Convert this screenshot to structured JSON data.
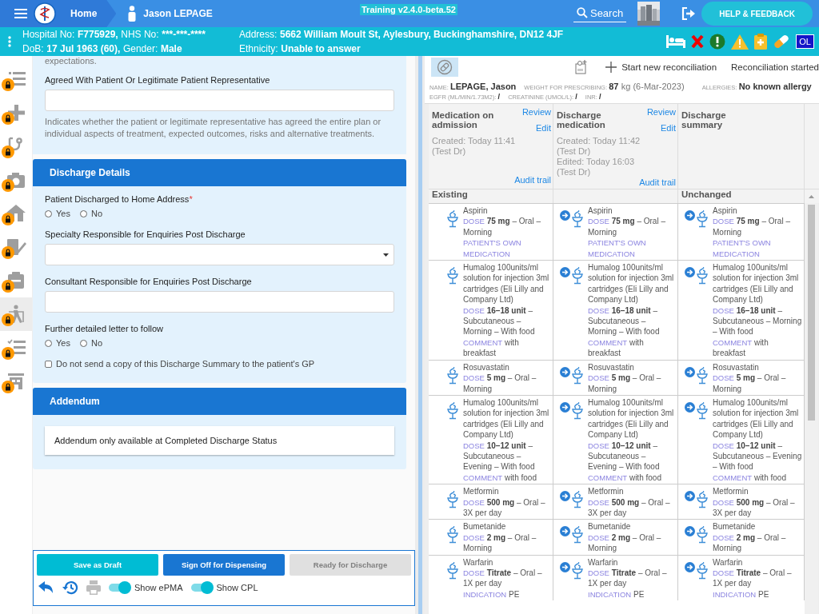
{
  "top_bar": {
    "home": "Home",
    "patient": "Jason LEPAGE",
    "environment": "Training v2.4.0-beta.52",
    "search": "Search",
    "help_button": "HELP & FEEDBACK"
  },
  "patient_banner": {
    "columns": [
      [
        [
          {
            "label": "Hospital No:",
            "value": "F775929,"
          },
          {
            "label": "NHS No:",
            "value": "***-***-****"
          }
        ],
        [
          {
            "label": "DoB:",
            "value": "17 Jul 1963 (60),"
          },
          {
            "label": "Gender:",
            "value": "Male"
          }
        ]
      ],
      [
        [
          {
            "label": "Address:",
            "value": "5662 William Moult St, Aylesbury, Buckinghamshire, DN12 4JF"
          }
        ],
        [
          {
            "label": "Ethnicity:",
            "value": "Unable to answer"
          }
        ]
      ]
    ],
    "alerts": [
      {
        "kind": "bed"
      },
      {
        "kind": "cross"
      },
      {
        "kind": "exclamation"
      },
      {
        "kind": "warning"
      },
      {
        "kind": "clipboard"
      },
      {
        "kind": "pill"
      },
      {
        "kind": "badge",
        "text": "OL"
      }
    ]
  },
  "sidebar": {
    "items": [
      {
        "kind": "list",
        "locked": true,
        "selected": false
      },
      {
        "kind": "plus",
        "locked": true,
        "selected": false
      },
      {
        "kind": "stethoscope",
        "locked": true,
        "selected": false
      },
      {
        "kind": "camera",
        "locked": true,
        "selected": false
      },
      {
        "kind": "home",
        "locked": true,
        "selected": false
      },
      {
        "kind": "edit",
        "locked": true,
        "selected": false
      },
      {
        "kind": "clipboard",
        "locked": true,
        "selected": false
      },
      {
        "kind": "walker",
        "locked": true,
        "selected": true
      },
      {
        "kind": "checklist",
        "locked": true,
        "selected": false
      },
      {
        "kind": "building",
        "locked": true,
        "selected": false
      }
    ]
  },
  "form": {
    "sections": [
      {
        "fields": [
          {
            "kind": "paragraph",
            "text": "expectations."
          },
          {
            "kind": "text",
            "label": "Agreed With Patient Or Legitimate Patient Representative",
            "help": "Indicates whether the patient or legitimate representative has agreed the entire plan or individual aspects of treatment, expected outcomes, risks and alternative treatments."
          }
        ]
      },
      {
        "title": "Discharge Details",
        "fields": [
          {
            "kind": "radio",
            "label": "Patient Discharged to Home Address",
            "required_mark": "*",
            "options": [
              {
                "label": "Yes",
                "selected": false
              },
              {
                "label": "No",
                "selected": false
              }
            ]
          },
          {
            "kind": "select",
            "label": "Specialty Responsible for Enquiries Post Discharge"
          },
          {
            "kind": "text",
            "label": "Consultant Responsible for Enquiries Post Discharge"
          },
          {
            "kind": "radio",
            "label": "Further detailed letter to follow",
            "options": [
              {
                "label": "Yes",
                "selected": false
              },
              {
                "label": "No",
                "selected": false
              }
            ]
          },
          {
            "kind": "checkbox",
            "label": "Do not send a copy of this Discharge Summary to the patient's GP",
            "checked": false
          }
        ]
      },
      {
        "title": "Addendum",
        "fields": [
          {
            "kind": "note",
            "text": "Addendum only available at Completed Discharge Status"
          }
        ]
      }
    ],
    "actions": [
      {
        "label": "Save as Draft",
        "kind": "draft",
        "disabled": false
      },
      {
        "label": "Sign Off for Dispensing",
        "kind": "sign",
        "disabled": false
      },
      {
        "label": "Ready for Discharge",
        "kind": "ready",
        "disabled": true
      }
    ],
    "tools": [
      {
        "kind": "undo",
        "disabled": false
      },
      {
        "kind": "history",
        "disabled": false
      },
      {
        "kind": "print",
        "disabled": true
      }
    ],
    "toggles": [
      {
        "label": "Show ePMA",
        "on": true
      },
      {
        "label": "Show CPL",
        "on": true
      }
    ]
  },
  "reconciliation": {
    "toolbar": {
      "start": "Start new reconciliation",
      "status": "Reconciliation started"
    },
    "patient": [
      [
        {
          "label": "NAME:",
          "value": "LEPAGE, Jason"
        },
        {
          "label": "WEIGHT FOR PRESCRIBING:",
          "value": "87",
          "unit": "kg (6-Mar-2023)"
        },
        {
          "label": "ALLERGIES:",
          "value": "No known allergy"
        }
      ],
      [
        {
          "label": "EGFR (ML/MIN/1.73M2):",
          "value": "/"
        },
        {
          "label": "CREATININE (UMOL/L):",
          "value": "/"
        },
        {
          "label": "INR:",
          "value": "/"
        }
      ]
    ],
    "columns": [
      {
        "title": "Medication on admission",
        "links": [
          "Review",
          "Edit"
        ],
        "history": [
          "Created: Today 11:41 (Test Dr)"
        ],
        "audit": "Audit trail"
      },
      {
        "title": "Discharge medication",
        "links": [
          "Review",
          "Edit"
        ],
        "history": [
          "Created: Today 11:42 (Test Dr)",
          "Edited: Today 16:03 (Test Dr)"
        ],
        "audit": "Audit trail"
      },
      {
        "title": "Discharge summary"
      }
    ],
    "group_labels": {
      "admission": "Existing",
      "summary": "Unchanged"
    },
    "medications": [
      {
        "cells": [
          {
            "linked": false,
            "name": "Aspirin",
            "dose_label": "DOSE",
            "dose": "75 mg",
            "details": "– Oral – Morning",
            "extra_label": "PATIENT'S OWN MEDICATION"
          },
          {
            "linked": true,
            "name": "Aspirin",
            "dose_label": "DOSE",
            "dose": "75 mg",
            "details": "– Oral – Morning",
            "extra_label": "PATIENT'S OWN MEDICATION"
          },
          {
            "linked": true,
            "name": "Aspirin",
            "dose_label": "DOSE",
            "dose": "75 mg",
            "details": "– Oral – Morning",
            "extra_label": "PATIENT'S OWN MEDICATION"
          }
        ]
      },
      {
        "cells": [
          {
            "linked": false,
            "name": "Humalog 100units/ml solution for injection 3ml cartridges (Eli Lilly and Company Ltd)",
            "dose_label": "DOSE",
            "dose": "16–18 unit",
            "details": "– Subcutaneous – Morning – With food",
            "extra_label": "COMMENT",
            "extra": "with breakfast"
          },
          {
            "linked": true,
            "name": "Humalog 100units/ml solution for injection 3ml cartridges (Eli Lilly and Company Ltd)",
            "dose_label": "DOSE",
            "dose": "16–18 unit",
            "details": "– Subcutaneous – Morning – With food",
            "extra_label": "COMMENT",
            "extra": "with breakfast"
          },
          {
            "linked": true,
            "name": "Humalog 100units/ml solution for injection 3ml cartridges (Eli Lilly and Company Ltd)",
            "dose_label": "DOSE",
            "dose": "16–18 unit",
            "details": "– Subcutaneous – Morning – With food",
            "extra_label": "COMMENT",
            "extra": "with breakfast"
          }
        ]
      },
      {
        "cells": [
          {
            "linked": false,
            "name": "Rosuvastatin",
            "dose_label": "DOSE",
            "dose": "5 mg",
            "details": "– Oral – Morning"
          },
          {
            "linked": true,
            "name": "Rosuvastatin",
            "dose_label": "DOSE",
            "dose": "5 mg",
            "details": "– Oral – Morning"
          },
          {
            "linked": true,
            "name": "Rosuvastatin",
            "dose_label": "DOSE",
            "dose": "5 mg",
            "details": "– Oral – Morning"
          }
        ]
      },
      {
        "cells": [
          {
            "linked": false,
            "name": "Humalog 100units/ml solution for injection 3ml cartridges (Eli Lilly and Company Ltd)",
            "dose_label": "DOSE",
            "dose": "10–12 unit",
            "details": "– Subcutaneous – Evening – With food",
            "extra_label": "COMMENT",
            "extra": "with food"
          },
          {
            "linked": true,
            "name": "Humalog 100units/ml solution for injection 3ml cartridges (Eli Lilly and Company Ltd)",
            "dose_label": "DOSE",
            "dose": "10–12 unit",
            "details": "– Subcutaneous – Evening – With food",
            "extra_label": "COMMENT",
            "extra": "with food"
          },
          {
            "linked": true,
            "name": "Humalog 100units/ml solution for injection 3ml cartridges (Eli Lilly and Company Ltd)",
            "dose_label": "DOSE",
            "dose": "10–12 unit",
            "details": "– Subcutaneous – Evening – With food",
            "extra_label": "COMMENT",
            "extra": "with food"
          }
        ]
      },
      {
        "cells": [
          {
            "linked": false,
            "name": "Metformin",
            "dose_label": "DOSE",
            "dose": "500 mg",
            "details": "– Oral – 3X per day"
          },
          {
            "linked": true,
            "name": "Metformin",
            "dose_label": "DOSE",
            "dose": "500 mg",
            "details": "– Oral – 3X per day"
          },
          {
            "linked": true,
            "name": "Metformin",
            "dose_label": "DOSE",
            "dose": "500 mg",
            "details": "– Oral – 3X per day"
          }
        ]
      },
      {
        "cells": [
          {
            "linked": false,
            "name": "Bumetanide",
            "dose_label": "DOSE",
            "dose": "2 mg",
            "details": "– Oral – Morning"
          },
          {
            "linked": true,
            "name": "Bumetanide",
            "dose_label": "DOSE",
            "dose": "2 mg",
            "details": "– Oral – Morning"
          },
          {
            "linked": true,
            "name": "Bumetanide",
            "dose_label": "DOSE",
            "dose": "2 mg",
            "details": "– Oral – Morning"
          }
        ]
      },
      {
        "cells": [
          {
            "linked": false,
            "name": "Warfarin",
            "dose_label": "DOSE",
            "dose": "Titrate",
            "details": "– Oral – 1X per day",
            "extra_label": "INDICATION",
            "extra": "PE"
          },
          {
            "linked": true,
            "name": "Warfarin",
            "dose_label": "DOSE",
            "dose": "Titrate",
            "details": "– Oral – 1X per day",
            "extra_label": "INDICATION",
            "extra": "PE"
          },
          {
            "linked": true,
            "name": "Warfarin",
            "dose_label": "DOSE",
            "dose": "Titrate",
            "details": "– Oral – 1X per day",
            "extra_label": "INDICATION",
            "extra": "PE"
          }
        ]
      }
    ]
  }
}
